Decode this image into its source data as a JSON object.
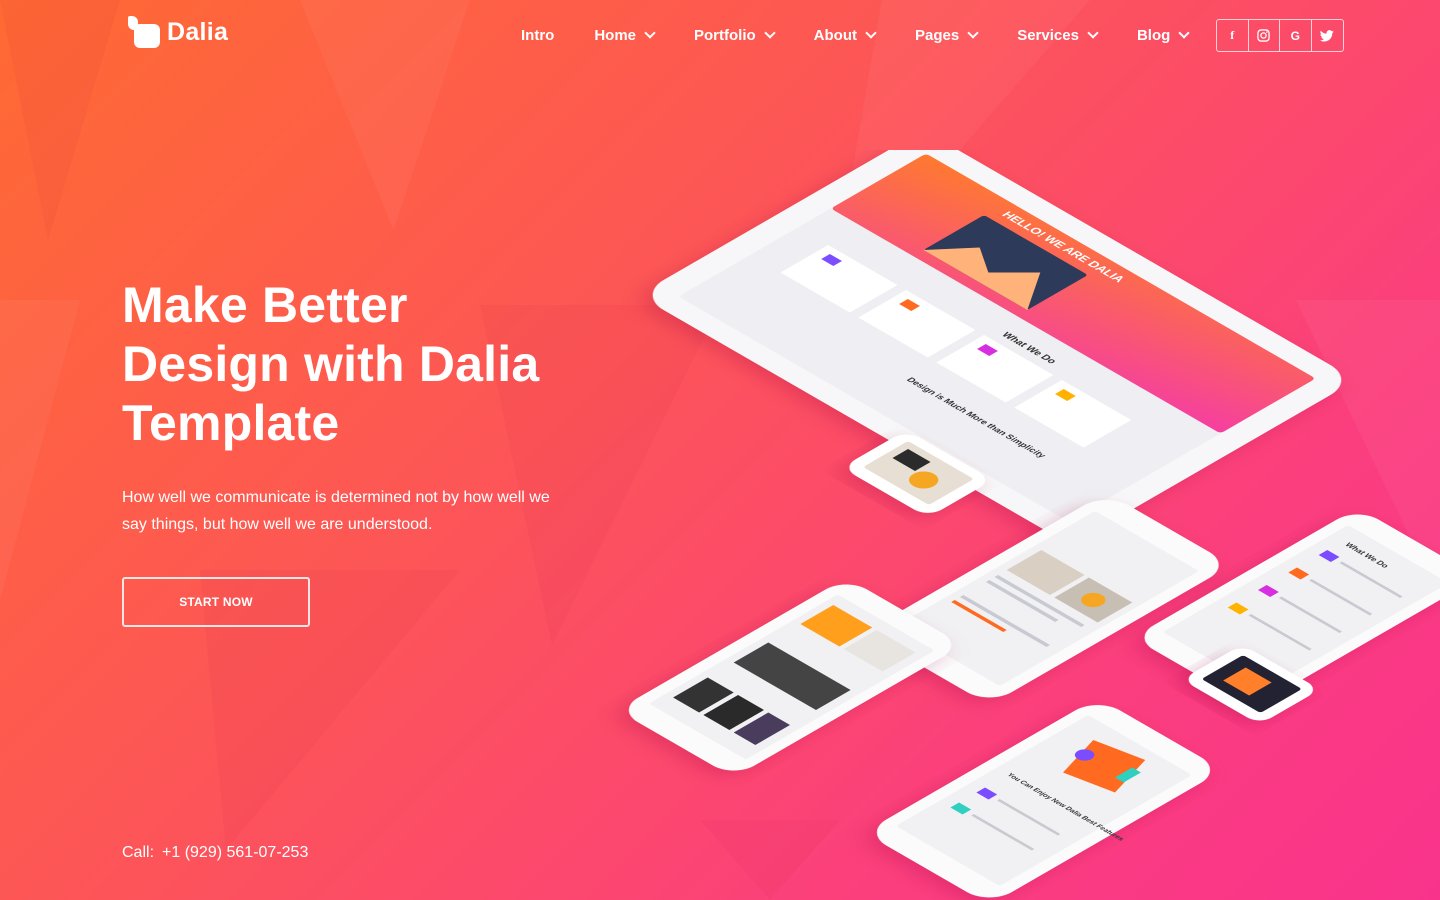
{
  "brand": {
    "name": "Dalia"
  },
  "nav": {
    "items": [
      {
        "label": "Intro",
        "has_dropdown": false
      },
      {
        "label": "Home",
        "has_dropdown": true
      },
      {
        "label": "Portfolio",
        "has_dropdown": true
      },
      {
        "label": "About",
        "has_dropdown": true
      },
      {
        "label": "Pages",
        "has_dropdown": true
      },
      {
        "label": "Services",
        "has_dropdown": true
      },
      {
        "label": "Blog",
        "has_dropdown": true
      }
    ],
    "social": [
      {
        "icon": "facebook-icon",
        "glyph": "f"
      },
      {
        "icon": "instagram-icon",
        "glyph": "◎"
      },
      {
        "icon": "google-plus-icon",
        "glyph": "G"
      },
      {
        "icon": "twitter-icon",
        "glyph": "t"
      }
    ]
  },
  "hero": {
    "title_line1": "Make Better",
    "title_line2": "Design with Dalia",
    "title_line3": "Template",
    "description": "How well we communicate is determined not by how well we say things, but how well we are understood.",
    "cta_label": "START NOW"
  },
  "contact": {
    "call_label": "Call:",
    "phone": "+1 (929) 561-07-253"
  },
  "mockup": {
    "tablet_heading": "HELLO! WE ARE DALIA",
    "tablet_section": "What We Do",
    "tablet_tagline": "Design is Much More than Simplicity",
    "phone_section": "What We Do",
    "phone_features": "You Can Enjoy New Dalia Best Features"
  },
  "colors": {
    "gradient_start": "#ff6a33",
    "gradient_end": "#f9338c",
    "text": "#ffffff"
  }
}
